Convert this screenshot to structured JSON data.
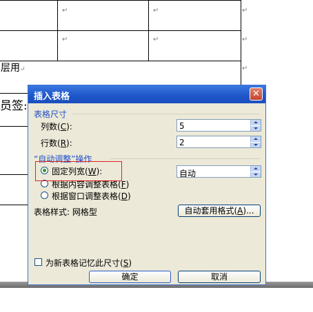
{
  "document": {
    "text_usage": "层用",
    "text_member_sign": "员签:"
  },
  "dialog": {
    "title": "插入表格",
    "close_symbol": "✕",
    "table_size": {
      "group_label": "表格尺寸",
      "columns_label": "列数",
      "columns_key": "C",
      "columns_value": "5",
      "rows_label": "行数",
      "rows_key": "R",
      "rows_value": "2"
    },
    "autofit": {
      "group_label": "“自动调整”操作",
      "fixed_width_label": "固定列宽",
      "fixed_width_key": "W",
      "fixed_width_value": "自动",
      "by_content_label": "根据内容调整表格",
      "by_content_key": "F",
      "by_window_label": "根据窗口调整表格",
      "by_window_key": "D",
      "selected": "fixed_width"
    },
    "table_style": {
      "label": "表格样式:",
      "value": "网格型",
      "autoformat_button": "自动套用格式",
      "autoformat_key": "A"
    },
    "remember": {
      "label": "为新表格记忆此尺寸",
      "key": "S",
      "checked": false
    },
    "ok_button": "确定",
    "cancel_button": "取消"
  },
  "colors": {
    "titlebar": "#1d55c8",
    "dialog_bg": "#ece9d8",
    "group_label": "#1f4fc7",
    "highlight": "#e02020"
  }
}
